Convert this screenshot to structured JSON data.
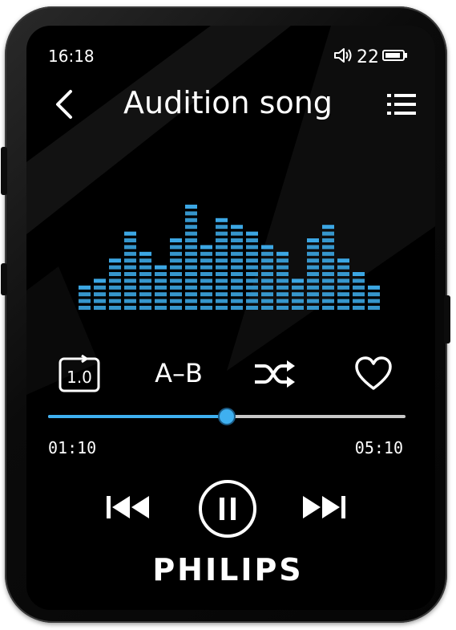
{
  "status": {
    "time": "16:18",
    "volume_level": "22",
    "volume_icon": "speaker-icon",
    "battery_icon": "battery-icon"
  },
  "header": {
    "back_icon": "chevron-left-icon",
    "title": "Audition song",
    "list_icon": "playlist-icon"
  },
  "visualizer": {
    "accent_color": "#3fb0f0",
    "bars_segments": [
      4,
      5,
      8,
      12,
      9,
      7,
      11,
      16,
      10,
      14,
      13,
      12,
      10,
      9,
      5,
      11,
      13,
      8,
      6,
      4
    ]
  },
  "modes": {
    "speed_label": "1.0",
    "ab_label": "A–B",
    "shuffle_icon": "shuffle-icon",
    "favorite_icon": "heart-icon"
  },
  "progress": {
    "current": "01:10",
    "total": "05:10",
    "fraction": 0.5
  },
  "transport": {
    "prev_icon": "previous-track-icon",
    "pause_icon": "pause-icon",
    "next_icon": "next-track-icon"
  },
  "brand": "PHILIPS"
}
